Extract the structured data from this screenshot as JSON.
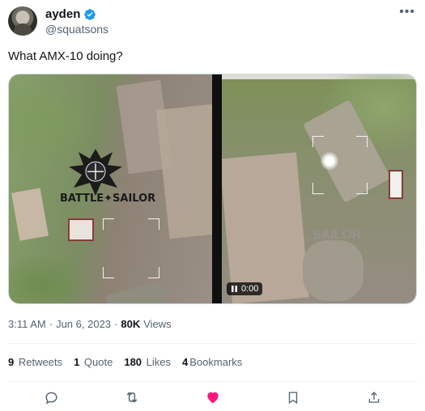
{
  "author": {
    "display_name": "ayden",
    "handle": "@squatsons"
  },
  "tweet": {
    "text": "What AMX-10 doing?"
  },
  "media": {
    "watermark_left": "BATTLE✦SAILOR",
    "watermark_right": "SAILOR",
    "video_time": "0:00"
  },
  "meta": {
    "time": "3:11 AM",
    "separator1": "·",
    "date": "Jun 6, 2023",
    "separator2": "·",
    "views_count": "80K",
    "views_label": "Views"
  },
  "stats": {
    "retweets_count": "9",
    "retweets_label": "Retweets",
    "quotes_count": "1",
    "quotes_label": "Quote",
    "likes_count": "180",
    "likes_label": "Likes",
    "bookmarks_count": "4",
    "bookmarks_label": "Bookmarks"
  },
  "colors": {
    "verified": "#1d9bf0",
    "liked": "#f91880",
    "muted_text": "#536471"
  },
  "icons": {
    "verified": "verified-badge-icon",
    "more": "more-icon",
    "reply": "reply-icon",
    "retweet": "retweet-icon",
    "like": "heart-icon",
    "bookmark": "bookmark-icon",
    "share": "share-icon",
    "pause": "pause-icon"
  }
}
